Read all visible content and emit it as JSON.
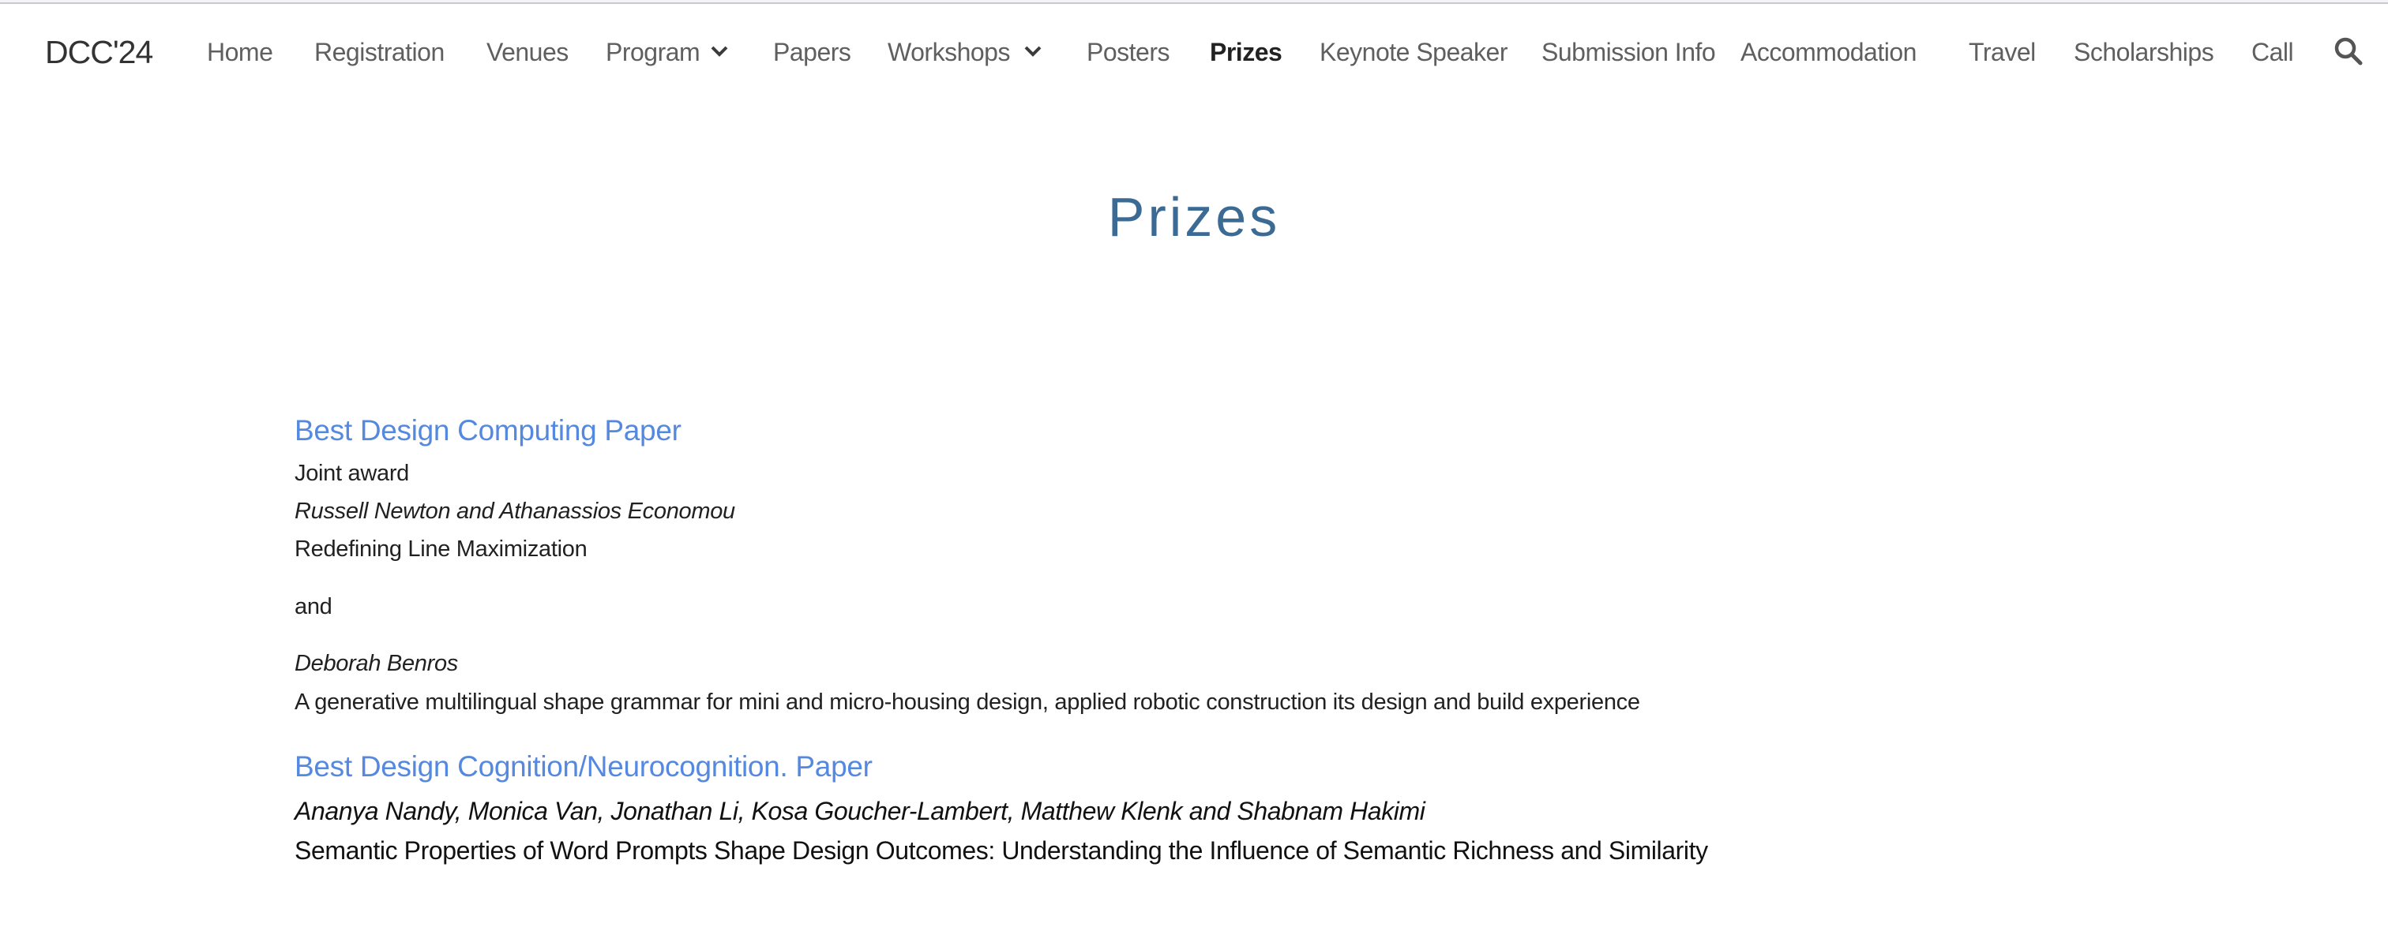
{
  "header": {
    "logo": "DCC'24",
    "nav": [
      {
        "label": "Home"
      },
      {
        "label": "Registration"
      },
      {
        "label": "Venues"
      },
      {
        "label": "Program",
        "has_dropdown": true
      },
      {
        "label": "Papers"
      },
      {
        "label": "Workshops",
        "has_dropdown": true
      },
      {
        "label": "Posters"
      },
      {
        "label": "Prizes",
        "active": true
      },
      {
        "label": "Keynote Speaker"
      },
      {
        "label": "Submission Info"
      },
      {
        "label": "Accommodation"
      },
      {
        "label": "Travel"
      },
      {
        "label": "Scholarships"
      },
      {
        "label": "Call"
      }
    ],
    "search_icon": "search-icon",
    "dropdown_icon": "chevron-down-icon"
  },
  "page": {
    "title": "Prizes"
  },
  "sections": [
    {
      "heading": "Best Design Computing Paper",
      "note": "Joint award",
      "awards": [
        {
          "authors": "Russell Newton and Athanassios Economou",
          "title": "Redefining Line Maximization"
        },
        {
          "authors": "Deborah Benros",
          "title": "A generative multilingual shape grammar for mini and micro-housing design, applied robotic construction its design and build experience"
        }
      ],
      "separator": "and"
    },
    {
      "heading": "Best Design Cognition/Neurocognition. Paper",
      "awards": [
        {
          "authors": "Ananya Nandy, Monica Van, Jonathan Li, Kosa Goucher-Lambert, Matthew Klenk and Shabnam Hakimi",
          "title": "Semantic Properties of Word Prompts Shape Design Outcomes: Understanding the Influence of Semantic Richness and Similarity"
        }
      ]
    }
  ],
  "colors": {
    "title": "#3b6a94",
    "section_heading": "#5589e0",
    "nav_text": "#5f5f5f",
    "nav_active": "#222222"
  }
}
